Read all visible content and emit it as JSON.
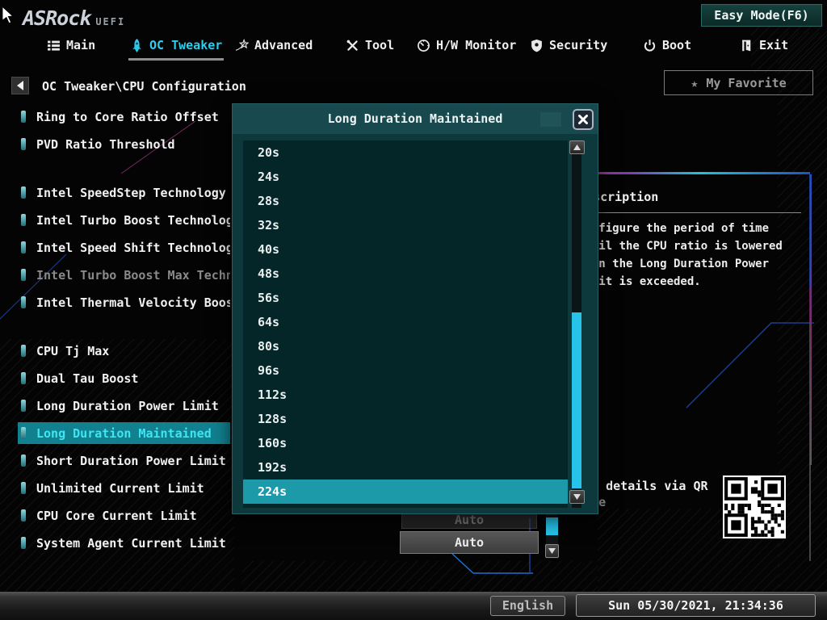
{
  "brand": {
    "logo_text": "ASRock",
    "uefi_text": "UEFI"
  },
  "top": {
    "easy_mode_label": "Easy Mode(F6)"
  },
  "nav": {
    "items": [
      {
        "id": "main",
        "label": "Main",
        "icon": "list-icon",
        "active": false
      },
      {
        "id": "oc-tweaker",
        "label": "OC Tweaker",
        "icon": "rocket-icon",
        "active": true
      },
      {
        "id": "advanced",
        "label": "Advanced",
        "icon": "star-swoosh-icon",
        "active": false
      },
      {
        "id": "tool",
        "label": "Tool",
        "icon": "tools-icon",
        "active": false
      },
      {
        "id": "hw-monitor",
        "label": "H/W Monitor",
        "icon": "gauge-icon",
        "active": false
      },
      {
        "id": "security",
        "label": "Security",
        "icon": "shield-icon",
        "active": false
      },
      {
        "id": "boot",
        "label": "Boot",
        "icon": "power-icon",
        "active": false
      },
      {
        "id": "exit",
        "label": "Exit",
        "icon": "exit-door-icon",
        "active": false
      }
    ]
  },
  "breadcrumb": {
    "label": "OC Tweaker\\CPU Configuration"
  },
  "favorite": {
    "label": "My Favorite",
    "icon": "star-icon",
    "star_glyph": "★"
  },
  "settings": {
    "items": [
      {
        "label": "Ring to Core Ratio Offset",
        "state": "normal",
        "gap_after": false
      },
      {
        "label": "PVD Ratio Threshold",
        "state": "normal",
        "gap_after": true
      },
      {
        "label": "Intel SpeedStep Technology",
        "state": "normal",
        "gap_after": false
      },
      {
        "label": "Intel Turbo Boost Technology",
        "state": "normal",
        "gap_after": false
      },
      {
        "label": "Intel Speed Shift Technology",
        "state": "normal",
        "gap_after": false
      },
      {
        "label": "Intel Turbo Boost Max Technology",
        "state": "disabled",
        "gap_after": false
      },
      {
        "label": "Intel Thermal Velocity Boost Volt",
        "state": "normal",
        "gap_after": true
      },
      {
        "label": "CPU Tj Max",
        "state": "normal",
        "gap_after": false
      },
      {
        "label": "Dual Tau Boost",
        "state": "normal",
        "gap_after": false
      },
      {
        "label": "Long Duration Power Limit",
        "state": "normal",
        "gap_after": false
      },
      {
        "label": "Long Duration Maintained",
        "state": "selected",
        "gap_after": false
      },
      {
        "label": "Short Duration Power Limit",
        "state": "normal",
        "gap_after": false
      },
      {
        "label": "Unlimited Current Limit",
        "state": "normal",
        "gap_after": false
      },
      {
        "label": "CPU Core Current Limit",
        "state": "normal",
        "gap_after": false
      },
      {
        "label": "System Agent Current Limit",
        "state": "normal",
        "gap_after": false
      }
    ]
  },
  "page_values": {
    "dim_value": "Auto",
    "value": "Auto"
  },
  "modal": {
    "title": "Long Duration Maintained",
    "options": [
      "20s",
      "24s",
      "28s",
      "32s",
      "40s",
      "48s",
      "56s",
      "64s",
      "80s",
      "96s",
      "112s",
      "128s",
      "160s",
      "192s",
      "224s"
    ],
    "selected": "224s"
  },
  "description": {
    "title": "Description",
    "lines": [
      "Configure the period of time",
      "until the CPU ratio is lowered",
      "when the Long Duration Power",
      "Limit is exceeded."
    ]
  },
  "qr": {
    "line1": "Get details via QR",
    "line2": "code"
  },
  "statusbar": {
    "language": "English",
    "datetime": "Sun 05/30/2021, 21:34:36"
  },
  "colors": {
    "accent": "#2bc8e8",
    "highlight_bg": "#11808f",
    "highlight_text": "#41e4f2",
    "modal_title_bg": "#17494e",
    "modal_body_bg": "#052628",
    "selected_option_bg": "#1d9aaa",
    "scroll_thumb": "#27c3e9"
  }
}
